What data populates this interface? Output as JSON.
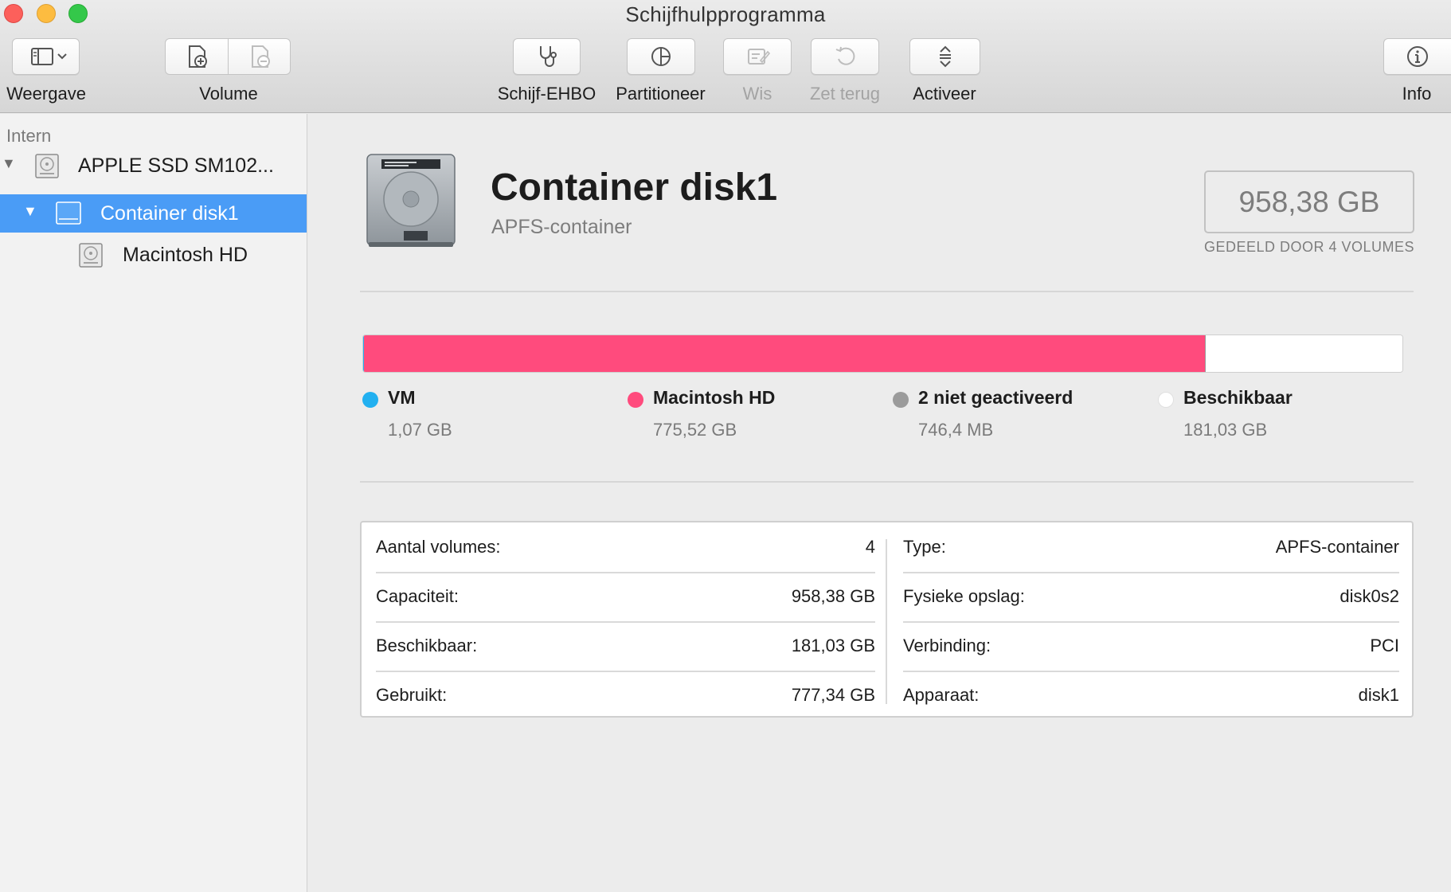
{
  "window": {
    "title": "Schijfhulpprogramma"
  },
  "toolbar": {
    "view_label": "Weergave",
    "volume_label": "Volume",
    "firstaid_label": "Schijf-EHBO",
    "partition_label": "Partitioneer",
    "erase_label": "Wis",
    "restore_label": "Zet terug",
    "mount_label": "Activeer",
    "info_label": "Info"
  },
  "sidebar": {
    "section": "Intern",
    "items": [
      {
        "label": "APPLE SSD SM102...",
        "level": 0,
        "icon": "internal-disk-icon",
        "selected": false,
        "expanded": true
      },
      {
        "label": "Container disk1",
        "level": 1,
        "icon": "container-icon",
        "selected": true,
        "expanded": true
      },
      {
        "label": "Macintosh HD",
        "level": 2,
        "icon": "volume-disk-icon",
        "selected": false
      }
    ]
  },
  "main": {
    "title": "Container disk1",
    "subtitle": "APFS-container",
    "capacity": "958,38 GB",
    "capacity_caption": "GEDEELD DOOR 4 VOLUMES",
    "usage": [
      {
        "name": "VM",
        "size": "1,07 GB",
        "color": "#22b0f0",
        "fraction": 0.0011
      },
      {
        "name": "Macintosh HD",
        "size": "775,52 GB",
        "color": "#ff4b7d",
        "fraction": 0.8092
      },
      {
        "name": "2 niet geactiveerd",
        "size": "746,4 MB",
        "color": "#9b9b9b",
        "fraction": 0.0008
      },
      {
        "name": "Beschikbaar",
        "size": "181,03 GB",
        "color": "#ffffff",
        "fraction": 0.1889
      }
    ],
    "info_left": [
      {
        "key": "Aantal volumes:",
        "value": "4"
      },
      {
        "key": "Capaciteit:",
        "value": "958,38 GB"
      },
      {
        "key": "Beschikbaar:",
        "value": "181,03 GB"
      },
      {
        "key": "Gebruikt:",
        "value": "777,34 GB"
      }
    ],
    "info_right": [
      {
        "key": "Type:",
        "value": "APFS-container"
      },
      {
        "key": "Fysieke opslag:",
        "value": "disk0s2"
      },
      {
        "key": "Verbinding:",
        "value": "PCI"
      },
      {
        "key": "Apparaat:",
        "value": "disk1"
      }
    ]
  }
}
